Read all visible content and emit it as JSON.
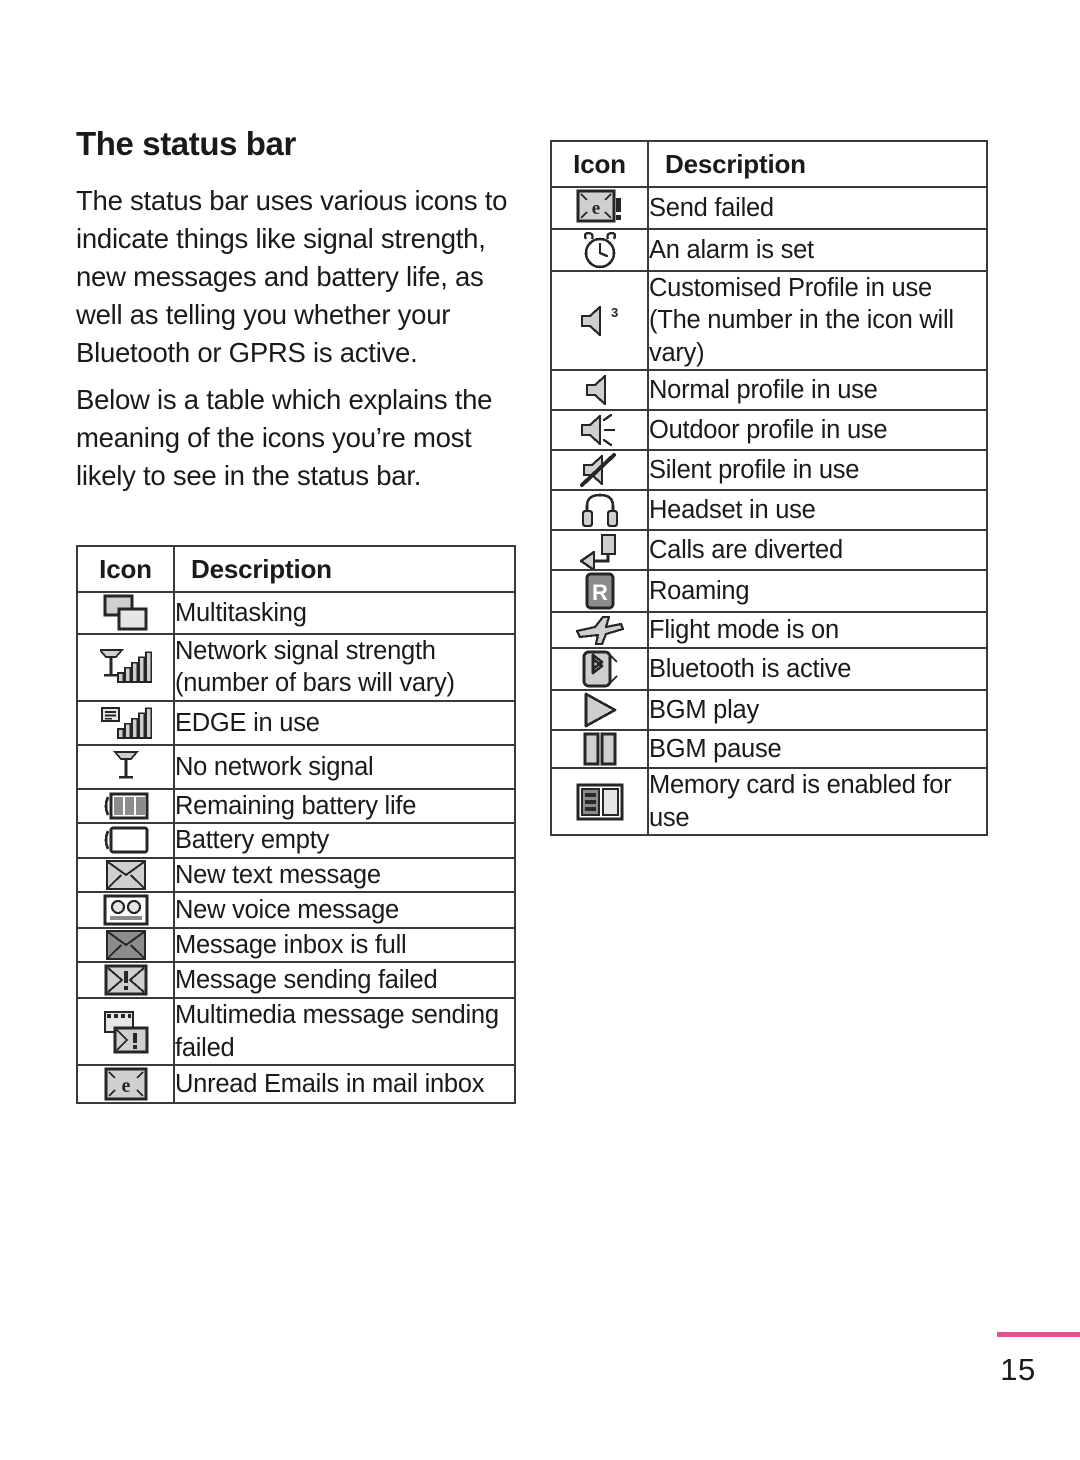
{
  "article": {
    "title": "The status bar",
    "paragraphs": [
      "The status bar uses various icons to indicate things like signal strength, new messages and battery life, as well as telling you whether your Bluetooth or GPRS is active.",
      "Below is a table which explains the meaning of the icons you’re most likely to see in the status bar."
    ]
  },
  "table_left": {
    "headers": {
      "icon": "Icon",
      "description": "Description"
    },
    "rows": [
      {
        "icon": "multitasking-icon",
        "description": "Multitasking"
      },
      {
        "icon": "signal-strength-icon",
        "description": "Network signal strength (number of bars will vary)"
      },
      {
        "icon": "edge-in-use-icon",
        "description": "EDGE in use"
      },
      {
        "icon": "no-network-signal-icon",
        "description": "No network signal"
      },
      {
        "icon": "battery-full-icon",
        "description": "Remaining battery life"
      },
      {
        "icon": "battery-empty-icon",
        "description": "Battery empty"
      },
      {
        "icon": "new-text-message-icon",
        "description": "New text message"
      },
      {
        "icon": "new-voice-message-icon",
        "description": "New voice message"
      },
      {
        "icon": "message-inbox-full-icon",
        "description": "Message inbox is full"
      },
      {
        "icon": "message-send-failed-icon",
        "description": "Message sending failed"
      },
      {
        "icon": "mms-send-failed-icon",
        "description": "Multimedia message sending failed"
      },
      {
        "icon": "unread-email-icon",
        "description": "Unread Emails in mail inbox"
      }
    ]
  },
  "table_right": {
    "headers": {
      "icon": "Icon",
      "description": "Description"
    },
    "rows": [
      {
        "icon": "email-send-failed-icon",
        "description": "Send failed"
      },
      {
        "icon": "alarm-clock-icon",
        "description": "An alarm is set"
      },
      {
        "icon": "customised-profile-icon",
        "description": "Customised Profile in use (The number in the icon will vary)"
      },
      {
        "icon": "normal-profile-icon",
        "description": "Normal profile in use"
      },
      {
        "icon": "outdoor-profile-icon",
        "description": "Outdoor profile in use"
      },
      {
        "icon": "silent-profile-icon",
        "description": "Silent profile in use"
      },
      {
        "icon": "headset-icon",
        "description": "Headset in use"
      },
      {
        "icon": "call-divert-icon",
        "description": "Calls are diverted"
      },
      {
        "icon": "roaming-icon",
        "description": "Roaming"
      },
      {
        "icon": "flight-mode-icon",
        "description": "Flight mode is on"
      },
      {
        "icon": "bluetooth-icon",
        "description": "Bluetooth is active"
      },
      {
        "icon": "bgm-play-icon",
        "description": "BGM play"
      },
      {
        "icon": "bgm-pause-icon",
        "description": "BGM pause"
      },
      {
        "icon": "memory-card-icon",
        "description": "Memory card is enabled for use"
      }
    ]
  },
  "footer": {
    "page_number": "15",
    "accent_color": "#e8508f"
  }
}
